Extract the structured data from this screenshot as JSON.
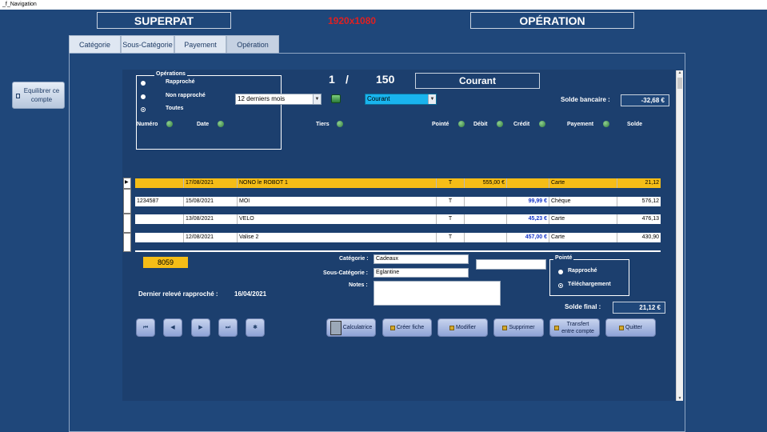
{
  "window": {
    "title": "_f_Navigation"
  },
  "header": {
    "app_title": "SUPERPAT",
    "resolution": "1920x1080",
    "section_title": "OPÉRATION"
  },
  "tabs": [
    {
      "label": "Catégorie"
    },
    {
      "label": "Sous-Catégorie"
    },
    {
      "label": "Payement"
    },
    {
      "label": "Opération"
    }
  ],
  "sidebar": {
    "balance_button": "Equilibrer ce compte"
  },
  "filter": {
    "group_label": "Opérations",
    "options": [
      "Rapproché",
      "Non rapproché",
      "Toutes"
    ],
    "period": "12 derniers mois",
    "account_select": "Courant"
  },
  "record": {
    "current": "1",
    "separator": "/",
    "total": "150",
    "account_name": "Courant"
  },
  "bank_balance": {
    "label": "Solde bancaire :",
    "value": "-32,68 €"
  },
  "columns": {
    "numero": "Numéro",
    "date": "Date",
    "tiers": "Tiers",
    "pointe": "Pointé",
    "debit": "Débit",
    "credit": "Crédit",
    "payement": "Payement",
    "solde": "Solde"
  },
  "rows": [
    {
      "numero": "",
      "date": "17/08/2021",
      "tiers": "NONO le ROBOT 1",
      "pointe": "T",
      "debit": "555,00 €",
      "credit": "",
      "payement": "Carte",
      "solde": "21,12"
    },
    {
      "numero": "1234587",
      "date": "15/08/2021",
      "tiers": "MOI",
      "pointe": "T",
      "debit": "",
      "credit": "99,99 €",
      "payement": "Chèque",
      "solde": "576,12"
    },
    {
      "numero": "",
      "date": "13/08/2021",
      "tiers": "VELO",
      "pointe": "T",
      "debit": "",
      "credit": "45,23 €",
      "payement": "Carte",
      "solde": "476,13"
    },
    {
      "numero": "",
      "date": "12/08/2021",
      "tiers": "Valise 2",
      "pointe": "T",
      "debit": "",
      "credit": "457,00 €",
      "payement": "Carte",
      "solde": "430,90"
    }
  ],
  "detail": {
    "id": "8059",
    "categorie_label": "Catégorie :",
    "categorie_value": "Cadeaux",
    "sous_categorie_label": "Sous-Catégorie :",
    "sous_categorie_value": "Eglantine",
    "notes_label": "Notes :",
    "notes_value": "",
    "extra_value": "",
    "dernier_releve_label": "Dernier relevé rapproché :",
    "dernier_releve_value": "16/04/2021",
    "pointe_group_label": "Pointé",
    "pointe_options": [
      "Rapproché",
      "Téléchargement"
    ],
    "solde_final_label": "Solde final :",
    "solde_final_value": "21,12 €"
  },
  "nav_buttons": [
    "first-icon",
    "previous-icon",
    "next-icon",
    "last-icon",
    "new-record-icon"
  ],
  "actions": {
    "calculatrice": "Calculatrice",
    "creer": "Créer fiche",
    "modifier": "Modifier",
    "supprimer": "Supprimer",
    "transfert": "Transfert entre compte",
    "quitter": "Quitter"
  },
  "colors": {
    "background": "#1f477a",
    "selected_row": "#f5bd17",
    "resolution_text": "#e02020",
    "detail_id": "#f5bd17"
  }
}
